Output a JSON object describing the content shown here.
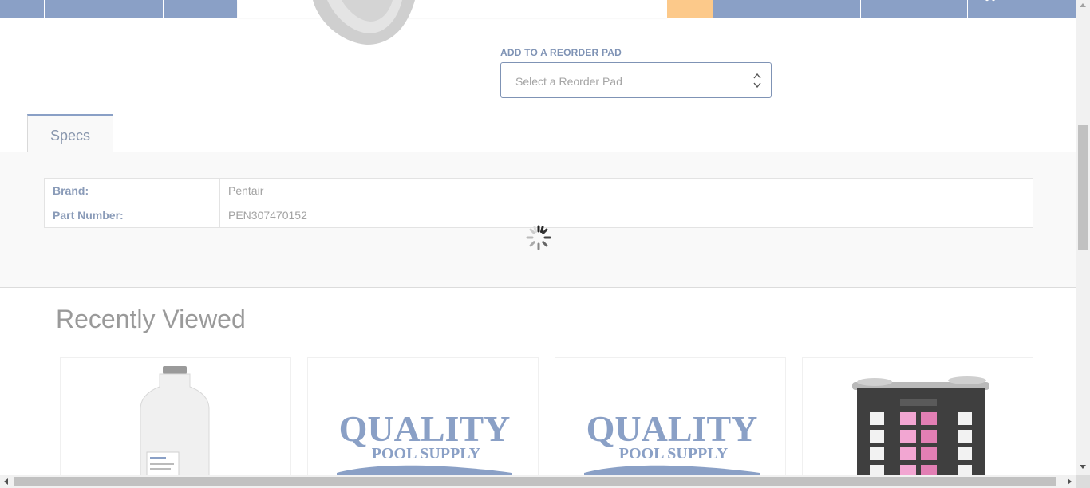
{
  "colors": {
    "nav": "#8aa0c6",
    "accent_orange": "#fcc98a",
    "label_blue": "#7f93b5"
  },
  "reorder": {
    "label": "ADD TO A REORDER PAD",
    "placeholder": "Select a Reorder Pad"
  },
  "tabs": [
    {
      "label": "Specs"
    }
  ],
  "specs": [
    {
      "key": "Brand:",
      "value": "Pentair"
    },
    {
      "key": "Part Number:",
      "value": "PEN307470152"
    }
  ],
  "recently_viewed": {
    "title": "Recently Viewed",
    "cards": [
      {
        "image": "jug-bottle-image"
      },
      {
        "image": "quality-pool-supply-logo",
        "logo_line1": "QUALITY",
        "logo_line2": "POOL SUPPLY"
      },
      {
        "image": "quality-pool-supply-logo",
        "logo_line1": "QUALITY",
        "logo_line2": "POOL SUPPLY"
      },
      {
        "image": "test-kit-image"
      }
    ]
  },
  "icons": {
    "cart": "cart-icon",
    "spinner": "loading-spinner-icon",
    "select_arrows": "chevron-up-down-icon"
  }
}
